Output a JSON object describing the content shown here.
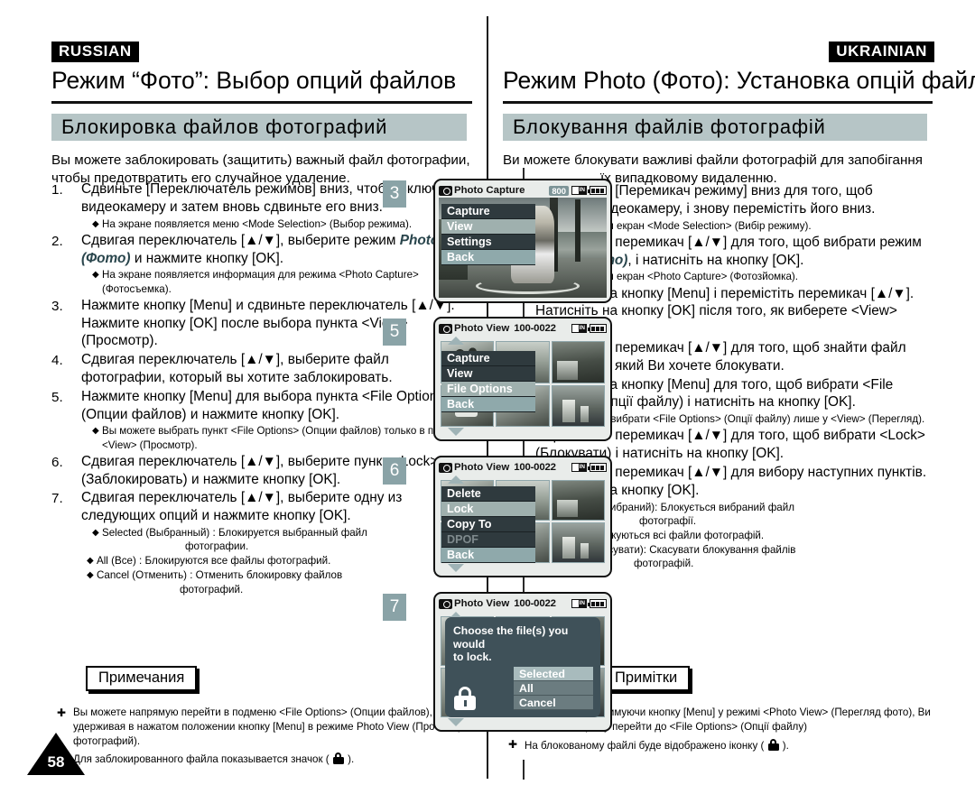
{
  "page": {
    "number": "58"
  },
  "russian": {
    "lang_tag": "RUSSIAN",
    "title": "Режим “Фото”: Выбор опций файлов",
    "section_heading": "Блокировка файлов фотографий",
    "intro_line1": "Вы можете заблокировать (защитить) важный файл фотографии,",
    "intro_line2": "чтобы предотвратить его случайное удаление.",
    "steps": [
      {
        "num": "1.",
        "text": "Сдвиньте [Переключатель режимов] вниз, чтобы включить видеокамеру и затем вновь сдвиньте его вниз.",
        "bullets": [
          "На экране появляется меню <Mode Selection> (Выбор режима)."
        ]
      },
      {
        "num": "2.",
        "text_pre": "Сдвигая переключатель [▲/▼], выберите режим ",
        "text_em": "Photo (Фото)",
        "text_post": " и нажмите кнопку [OK].",
        "bullets": [
          "На экране появляется информация для режима <Photo Capture> (Фотосъемка)."
        ]
      },
      {
        "num": "3.",
        "text": "Нажмите кнопку [Menu] и сдвиньте переключатель [▲/▼]. Нажмите кнопку [OK] после выбора пункта <View> (Просмотр).",
        "bullets": []
      },
      {
        "num": "4.",
        "text": "Сдвигая переключатель [▲/▼], выберите файл фотографии, который вы хотите заблокировать.",
        "bullets": []
      },
      {
        "num": "5.",
        "text": "Нажмите кнопку [Menu] для выбора пункта <File Options> (Опции файлов) и нажмите кнопку [OK].",
        "bullets": [
          "Вы можете выбрать пункт <File Options> (Опции файлов) только в подменю <View> (Просмотр)."
        ]
      },
      {
        "num": "6.",
        "text": "Сдвигая переключатель [▲/▼], выберите пункт <Lock> (Заблокировать) и нажмите кнопку [OK].",
        "bullets": []
      },
      {
        "num": "7.",
        "text": "Сдвигая переключатель [▲/▼], выберите одну из следующих опций и нажмите кнопку [OK].",
        "bullets": []
      }
    ],
    "option_bullets": [
      {
        "main": "Selected (Выбранный) : Блокируется выбранный файл",
        "indent": "фотографии."
      },
      {
        "main": "All (Все) : Блокируются все файлы фотографий.",
        "indent": ""
      },
      {
        "main": "Cancel (Отменить) : Отменить блокировку файлов",
        "indent": "фотографий."
      }
    ],
    "notes_label": "Примечания",
    "notes": [
      {
        "text": "Вы можете напрямую перейти в подменю <File Options> (Опции файлов), удерживая в нажатом положении кнопку [Menu] в режиме Photo View (Просмотр фотографий).",
        "lock": false
      },
      {
        "text_pre": "Для заблокированного файла показывается значок ( ",
        "text_post": " ).",
        "lock": true
      }
    ]
  },
  "ukrainian": {
    "lang_tag": "UKRAINIAN",
    "title": "Режим Photo (Фото): Установка опцій файлу",
    "section_heading": "Блокування файлів фотографій",
    "intro_line1": "Ви можете блокувати важливі файли фотографій для запобігання",
    "intro_line2": "їх випадковому видаленню.",
    "steps": [
      {
        "num": "1.",
        "text": "Перемістіть [Перемикач режиму] вниз для того, щоб включити відеокамеру, і знову перемістіть його вниз.",
        "bullets": [
          "З'являється екран <Mode Selection> (Вибір режиму)."
        ]
      },
      {
        "num": "2.",
        "text_pre": "Перемістіть перемикач [▲/▼] для того, щоб вибрати режим ",
        "text_em": "Photo (Фото)",
        "text_post": ", і натисніть на кнопку [OK].",
        "bullets": [
          "З'являється екран <Photo Capture> (Фотозйомка)."
        ]
      },
      {
        "num": "3.",
        "text": "Натисніть на кнопку [Menu] і перемістіть перемикач [▲/▼]. Натисніть на кнопку [OK] після того, як виберете <View> (Перегляд).",
        "bullets": []
      },
      {
        "num": "4.",
        "text": "Перемістіть перемикач [▲/▼] для того, щоб знайти файл фотографії, який Ви хочете блокувати.",
        "bullets": []
      },
      {
        "num": "5.",
        "text": "Натисніть на кнопку [Menu] для того, щоб вибрати <File Options> (Опції файлу) і натисніть на кнопку [OK].",
        "bullets": [
          "Ви можете вибрати <File Options> (Опції файлу) лише у <View> (Перегляд)."
        ]
      },
      {
        "num": "6.",
        "text": "Перемістіть перемикач [▲/▼] для того, щоб вибрати <Lock> (Блокувати) і натисніть на кнопку [OK].",
        "bullets": []
      },
      {
        "num": "7.",
        "text": "Перемістіть перемикач [▲/▼] для вибору наступних пунктів. Натисніть на кнопку [OK].",
        "bullets": []
      }
    ],
    "option_bullets": [
      {
        "main": "Selected (Вибраний): Блокується вибраний файл",
        "indent": "фотографії."
      },
      {
        "main": "All (Всі): Блокуються всі файли фотографій.",
        "indent": ""
      },
      {
        "main": "Cancel (Скасувати): Скасувати блокування файлів",
        "indent": "фотографій."
      }
    ],
    "notes_label": "Примітки",
    "notes": [
      {
        "text": "Натиснувши і утримуючи кнопку [Menu] у режимі <Photo View> (Перегляд фото), Ви зможете напряму перейти до <File Options> (Опції файлу)",
        "lock": false
      },
      {
        "text_pre": "На блокованому файлі буде відображено іконку ( ",
        "text_post": " ).",
        "lock": true
      }
    ]
  },
  "screens": [
    {
      "badge": "3",
      "title": "Photo Capture",
      "file": "",
      "counter": "800",
      "memory": "IN",
      "menu": [
        {
          "label": "Capture",
          "state": "normal"
        },
        {
          "label": "View",
          "state": "selected"
        },
        {
          "label": "Settings",
          "state": "normal"
        },
        {
          "label": "Back",
          "state": "highlight"
        }
      ]
    },
    {
      "badge": "5",
      "title": "Photo View",
      "file": "100-0022",
      "counter": "",
      "memory": "IN",
      "menu": [
        {
          "label": "Capture",
          "state": "normal"
        },
        {
          "label": "View",
          "state": "normal"
        },
        {
          "label": "File Options",
          "state": "selected"
        },
        {
          "label": "Back",
          "state": "highlight"
        }
      ]
    },
    {
      "badge": "6",
      "title": "Photo View",
      "file": "100-0022",
      "counter": "",
      "memory": "IN",
      "menu": [
        {
          "label": "Delete",
          "state": "normal"
        },
        {
          "label": "Lock",
          "state": "selected"
        },
        {
          "label": "Copy To",
          "state": "normal"
        },
        {
          "label": "DPOF",
          "state": "dim"
        },
        {
          "label": "Back",
          "state": "highlight"
        }
      ]
    },
    {
      "badge": "7",
      "title": "Photo View",
      "file": "100-0022",
      "counter": "",
      "memory": "IN",
      "dialog": {
        "message_line1": "Choose the file(s) you would",
        "message_line2": "to lock.",
        "buttons": [
          {
            "label": "Selected",
            "state": "selected"
          },
          {
            "label": "All",
            "state": "normal"
          },
          {
            "label": "Cancel",
            "state": "normal"
          }
        ]
      }
    }
  ],
  "colors": {
    "accent_bar": "#b6c5c6",
    "badge": "#8aa3a7",
    "menu_bg": "#2f3a3e",
    "menu_selected": "#9fb0ae",
    "dialog_bg": "#3f5159"
  }
}
